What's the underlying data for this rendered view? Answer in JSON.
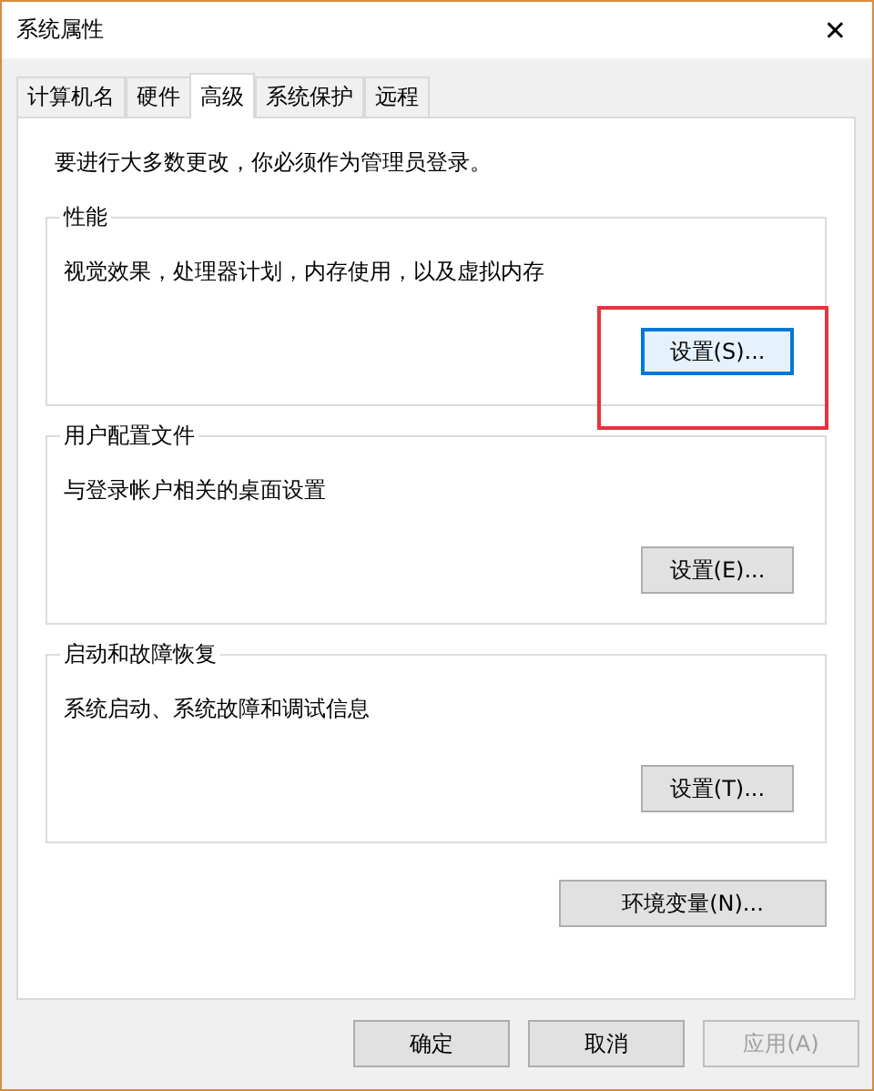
{
  "window": {
    "title": "系统属性",
    "close": "✕"
  },
  "tabs": [
    {
      "label": "计算机名",
      "selected": false
    },
    {
      "label": "硬件",
      "selected": false
    },
    {
      "label": "高级",
      "selected": true
    },
    {
      "label": "系统保护",
      "selected": false
    },
    {
      "label": "远程",
      "selected": false
    }
  ],
  "notice": "要进行大多数更改，你必须作为管理员登录。",
  "groups": [
    {
      "title": "性能",
      "description": "视觉效果，处理器计划，内存使用，以及虚拟内存",
      "button": "设置(S)...",
      "highlighted": true,
      "focused": true
    },
    {
      "title": "用户配置文件",
      "description": "与登录帐户相关的桌面设置",
      "button": "设置(E)...",
      "highlighted": false,
      "focused": false
    },
    {
      "title": "启动和故障恢复",
      "description": "系统启动、系统故障和调试信息",
      "button": "设置(T)...",
      "highlighted": false,
      "focused": false
    }
  ],
  "env_button": "环境变量(N)...",
  "buttons": [
    {
      "label": "确定",
      "disabled": false
    },
    {
      "label": "取消",
      "disabled": false
    },
    {
      "label": "应用(A)",
      "disabled": true
    }
  ]
}
